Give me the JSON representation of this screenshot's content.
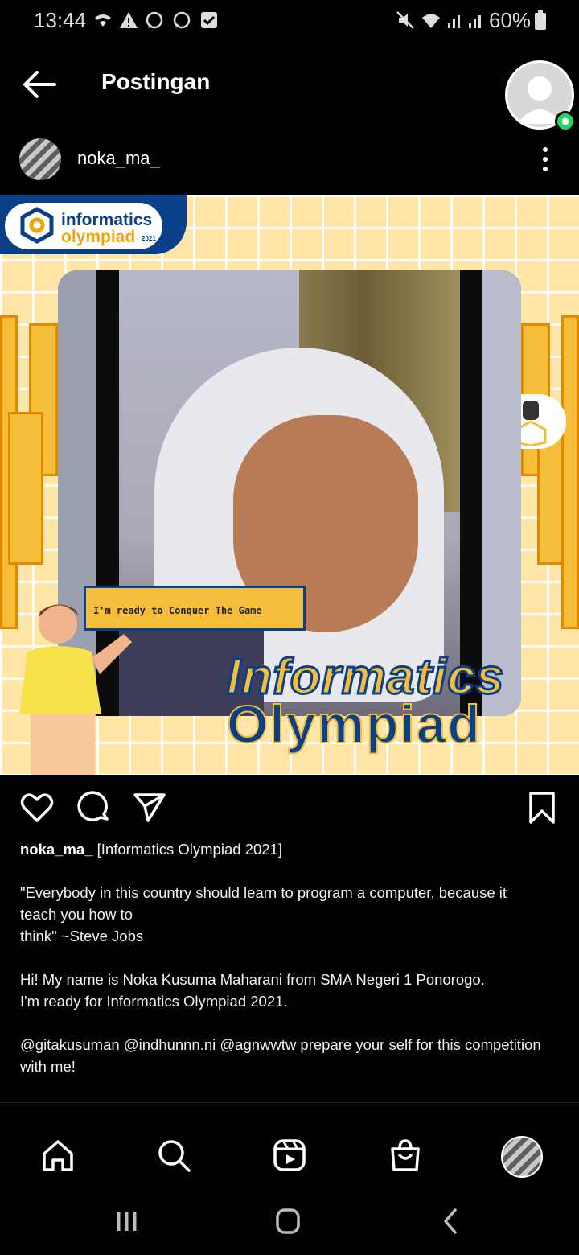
{
  "status_bar": {
    "time": "13:44",
    "battery": "60%",
    "left_icons": [
      "wifi-call-icon",
      "warning-icon",
      "whatsapp-icon",
      "whatsapp-icon",
      "check-square-icon"
    ],
    "right_icons": [
      "mute-icon",
      "wifi-icon",
      "signal-icon",
      "signal-icon",
      "battery-icon"
    ]
  },
  "header": {
    "title": "Postingan",
    "back_icon": "back-arrow-icon"
  },
  "post": {
    "username": "noka_ma_",
    "image": {
      "logo_line1": "informatics",
      "logo_line2": "olympiad",
      "logo_year": "2021",
      "ready_text": "I'm ready to Conquer The Game",
      "title_line1": "Informatics",
      "title_line2": "Olympiad"
    },
    "actions": [
      "heart-icon",
      "comment-icon",
      "share-icon",
      "bookmark-icon"
    ],
    "caption": {
      "username": "noka_ma_",
      "first_line": "[Informatics Olympiad 2021]",
      "quote_line1": "\"Everybody in this country should learn to program a computer, because it",
      "quote_line2": "teach you how to",
      "quote_line3": "think\" ~Steve Jobs",
      "intro_line1": "Hi! My name is Noka Kusuma Maharani from SMA Negeri 1 Ponorogo.",
      "intro_line2": "I'm ready for Informatics Olympiad 2021.",
      "mention_line1": "@gitakusuman @indhunnn.ni @agnwwtw prepare your self for this competition",
      "mention_line2": "with me!"
    }
  },
  "bottom_nav": [
    "home-icon",
    "search-icon",
    "reels-icon",
    "shop-icon",
    "profile-avatar"
  ],
  "system_nav": [
    "recents-icon",
    "home-circle-icon",
    "back-icon"
  ],
  "colors": {
    "background": "#000000",
    "text": "#ffffff",
    "poster_yellow": "#ffe6a6",
    "poster_blue": "#0a3f8a",
    "poster_orange": "#f5bd3a",
    "whatsapp_green": "#25d366"
  }
}
